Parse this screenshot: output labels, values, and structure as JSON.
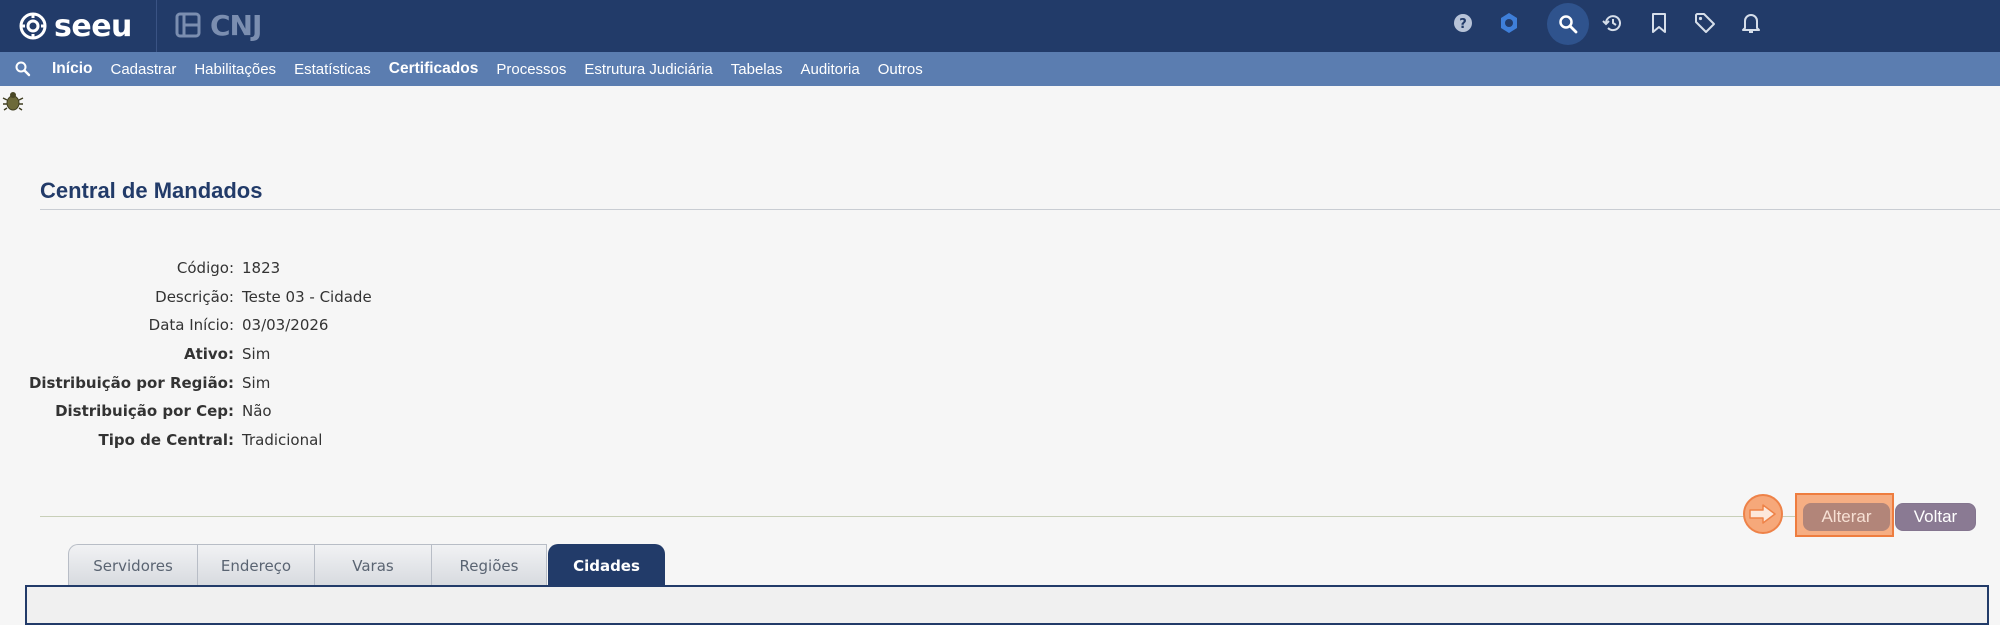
{
  "header": {
    "logo_text": "seeu",
    "cnj_text": "CNJ",
    "icons": [
      "help-icon",
      "settings-icon",
      "search-icon",
      "history-icon",
      "bookmark-icon",
      "tag-icon",
      "bell-icon"
    ]
  },
  "nav": {
    "items": [
      {
        "label": "Início",
        "bold": true
      },
      {
        "label": "Cadastrar",
        "bold": false
      },
      {
        "label": "Habilitações",
        "bold": false
      },
      {
        "label": "Estatísticas",
        "bold": false
      },
      {
        "label": "Certificados",
        "bold": true
      },
      {
        "label": "Processos",
        "bold": false
      },
      {
        "label": "Estrutura Judiciária",
        "bold": false
      },
      {
        "label": "Tabelas",
        "bold": false
      },
      {
        "label": "Auditoria",
        "bold": false
      },
      {
        "label": "Outros",
        "bold": false
      }
    ]
  },
  "page": {
    "title": "Central de Mandados"
  },
  "fields": [
    {
      "label": "Código:",
      "value": "1823",
      "bold": false
    },
    {
      "label": "Descrição:",
      "value": "Teste 03 - Cidade",
      "bold": false
    },
    {
      "label": "Data Início:",
      "value": "03/03/2026",
      "bold": false
    },
    {
      "label": "Ativo:",
      "value": "Sim",
      "bold": true
    },
    {
      "label": "Distribuição por Região:",
      "value": "Sim",
      "bold": true
    },
    {
      "label": "Distribuição por Cep:",
      "value": "Não",
      "bold": true
    },
    {
      "label": "Tipo de Central:",
      "value": "Tradicional",
      "bold": true
    }
  ],
  "actions": {
    "alterar_label": "Alterar",
    "voltar_label": "Voltar"
  },
  "tabs": [
    {
      "label": "Servidores",
      "active": false
    },
    {
      "label": "Endereço",
      "active": false
    },
    {
      "label": "Varas",
      "active": false
    },
    {
      "label": "Regiões",
      "active": false
    },
    {
      "label": "Cidades",
      "active": true
    }
  ],
  "colors": {
    "header_bg": "#223b69",
    "nav_bg": "#5b7db0",
    "highlight": "#ee7d3f"
  }
}
